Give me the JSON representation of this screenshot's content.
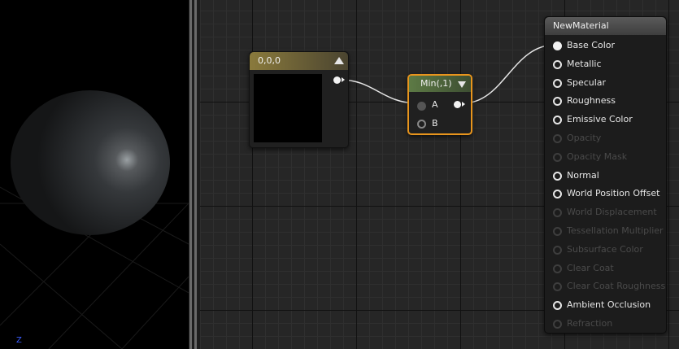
{
  "preview": {
    "axis_label": "Z"
  },
  "constant_node": {
    "title": "0,0,0",
    "swatch_color": "#000000",
    "header_color": "#8a7a3c"
  },
  "min_node": {
    "title": "Min(,1)",
    "input_a": "A",
    "input_b": "B",
    "selection_color": "#e8951d"
  },
  "material_node": {
    "title": "NewMaterial",
    "inputs": [
      {
        "label": "Base Color",
        "enabled": true,
        "connected": true
      },
      {
        "label": "Metallic",
        "enabled": true,
        "connected": false
      },
      {
        "label": "Specular",
        "enabled": true,
        "connected": false
      },
      {
        "label": "Roughness",
        "enabled": true,
        "connected": false
      },
      {
        "label": "Emissive Color",
        "enabled": true,
        "connected": false
      },
      {
        "label": "Opacity",
        "enabled": false,
        "connected": false
      },
      {
        "label": "Opacity Mask",
        "enabled": false,
        "connected": false
      },
      {
        "label": "Normal",
        "enabled": true,
        "connected": false
      },
      {
        "label": "World Position Offset",
        "enabled": true,
        "connected": false
      },
      {
        "label": "World Displacement",
        "enabled": false,
        "connected": false
      },
      {
        "label": "Tessellation Multiplier",
        "enabled": false,
        "connected": false
      },
      {
        "label": "Subsurface Color",
        "enabled": false,
        "connected": false
      },
      {
        "label": "Clear Coat",
        "enabled": false,
        "connected": false
      },
      {
        "label": "Clear Coat Roughness",
        "enabled": false,
        "connected": false
      },
      {
        "label": "Ambient Occlusion",
        "enabled": true,
        "connected": false
      },
      {
        "label": "Refraction",
        "enabled": false,
        "connected": false
      }
    ]
  }
}
